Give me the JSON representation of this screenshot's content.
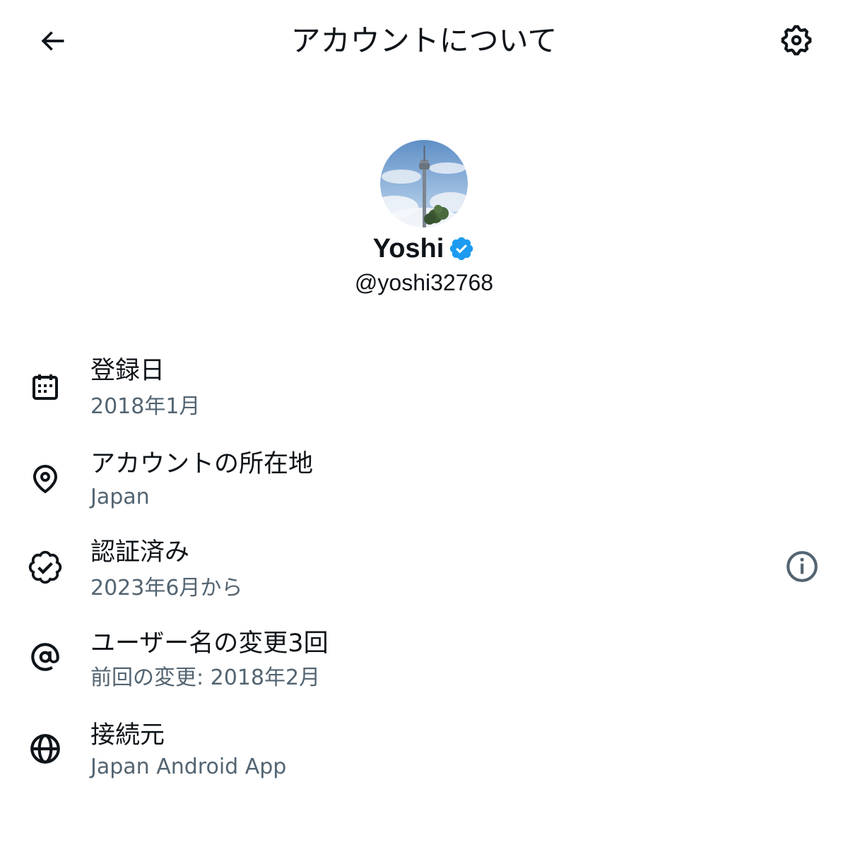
{
  "header": {
    "title": "アカウントについて",
    "back_icon": "arrow-left-icon",
    "settings_icon": "gear-icon"
  },
  "profile": {
    "display_name": "Yoshi",
    "handle": "@yoshi32768",
    "verified": true,
    "badge_color": "#1d9bf0",
    "avatar": "tower-photo"
  },
  "rows": [
    {
      "icon": "calendar-icon",
      "title": "登録日",
      "subtitle": "2018年1月"
    },
    {
      "icon": "location-pin-icon",
      "title": "アカウントの所在地",
      "subtitle": "Japan"
    },
    {
      "icon": "verified-check-icon",
      "title": "認証済み",
      "subtitle": "2023年6月から",
      "action_icon": "info-icon"
    },
    {
      "icon": "at-sign-icon",
      "title": "ユーザー名の変更3回",
      "subtitle": "前回の変更: 2018年2月"
    },
    {
      "icon": "globe-icon",
      "title": "接続元",
      "subtitle": "Japan Android App"
    }
  ],
  "colors": {
    "text_primary": "#0f1419",
    "text_secondary": "#536471",
    "icon": "#0f1419",
    "accent": "#1d9bf0"
  }
}
